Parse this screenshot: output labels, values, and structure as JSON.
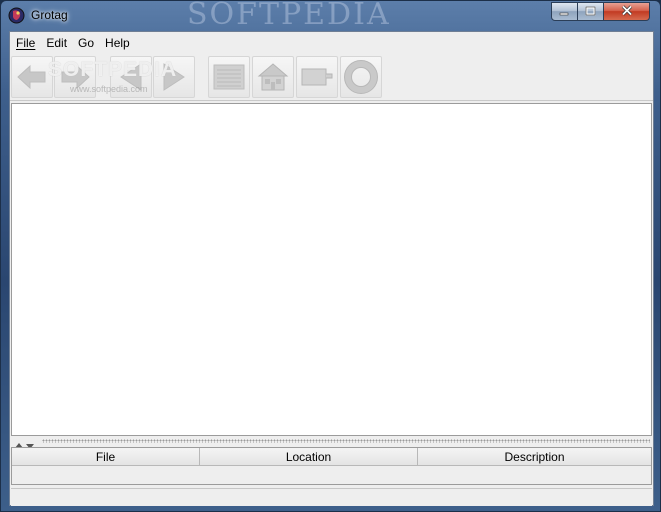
{
  "window": {
    "title": "Grotag",
    "watermark": "SOFTPEDIA"
  },
  "menu": {
    "items": [
      {
        "label": "File",
        "mnemonic": "F"
      },
      {
        "label": "Edit",
        "mnemonic": "E"
      },
      {
        "label": "Go",
        "mnemonic": "G"
      },
      {
        "label": "Help",
        "mnemonic": "H"
      }
    ]
  },
  "toolbar": {
    "buttons": [
      {
        "name": "back",
        "icon": "arrow-left-icon",
        "enabled": false
      },
      {
        "name": "forward",
        "icon": "arrow-right-icon",
        "enabled": false
      },
      {
        "name": "previous",
        "icon": "triangle-left-icon",
        "enabled": false
      },
      {
        "name": "next",
        "icon": "triangle-right-icon",
        "enabled": false
      },
      {
        "name": "contents",
        "icon": "list-icon",
        "enabled": false
      },
      {
        "name": "home",
        "icon": "house-icon",
        "enabled": false
      },
      {
        "name": "index",
        "icon": "tag-icon",
        "enabled": false
      },
      {
        "name": "help",
        "icon": "lifebuoy-icon",
        "enabled": false
      }
    ],
    "watermark": "SOFTPEDIA",
    "watermark_url": "www.softpedia.com"
  },
  "table": {
    "columns": [
      "File",
      "Location",
      "Description"
    ],
    "rows": []
  },
  "colors": {
    "disabled_icon": "#c7c7c7",
    "client_bg": "#eeeeee",
    "content_bg": "#ffffff"
  }
}
